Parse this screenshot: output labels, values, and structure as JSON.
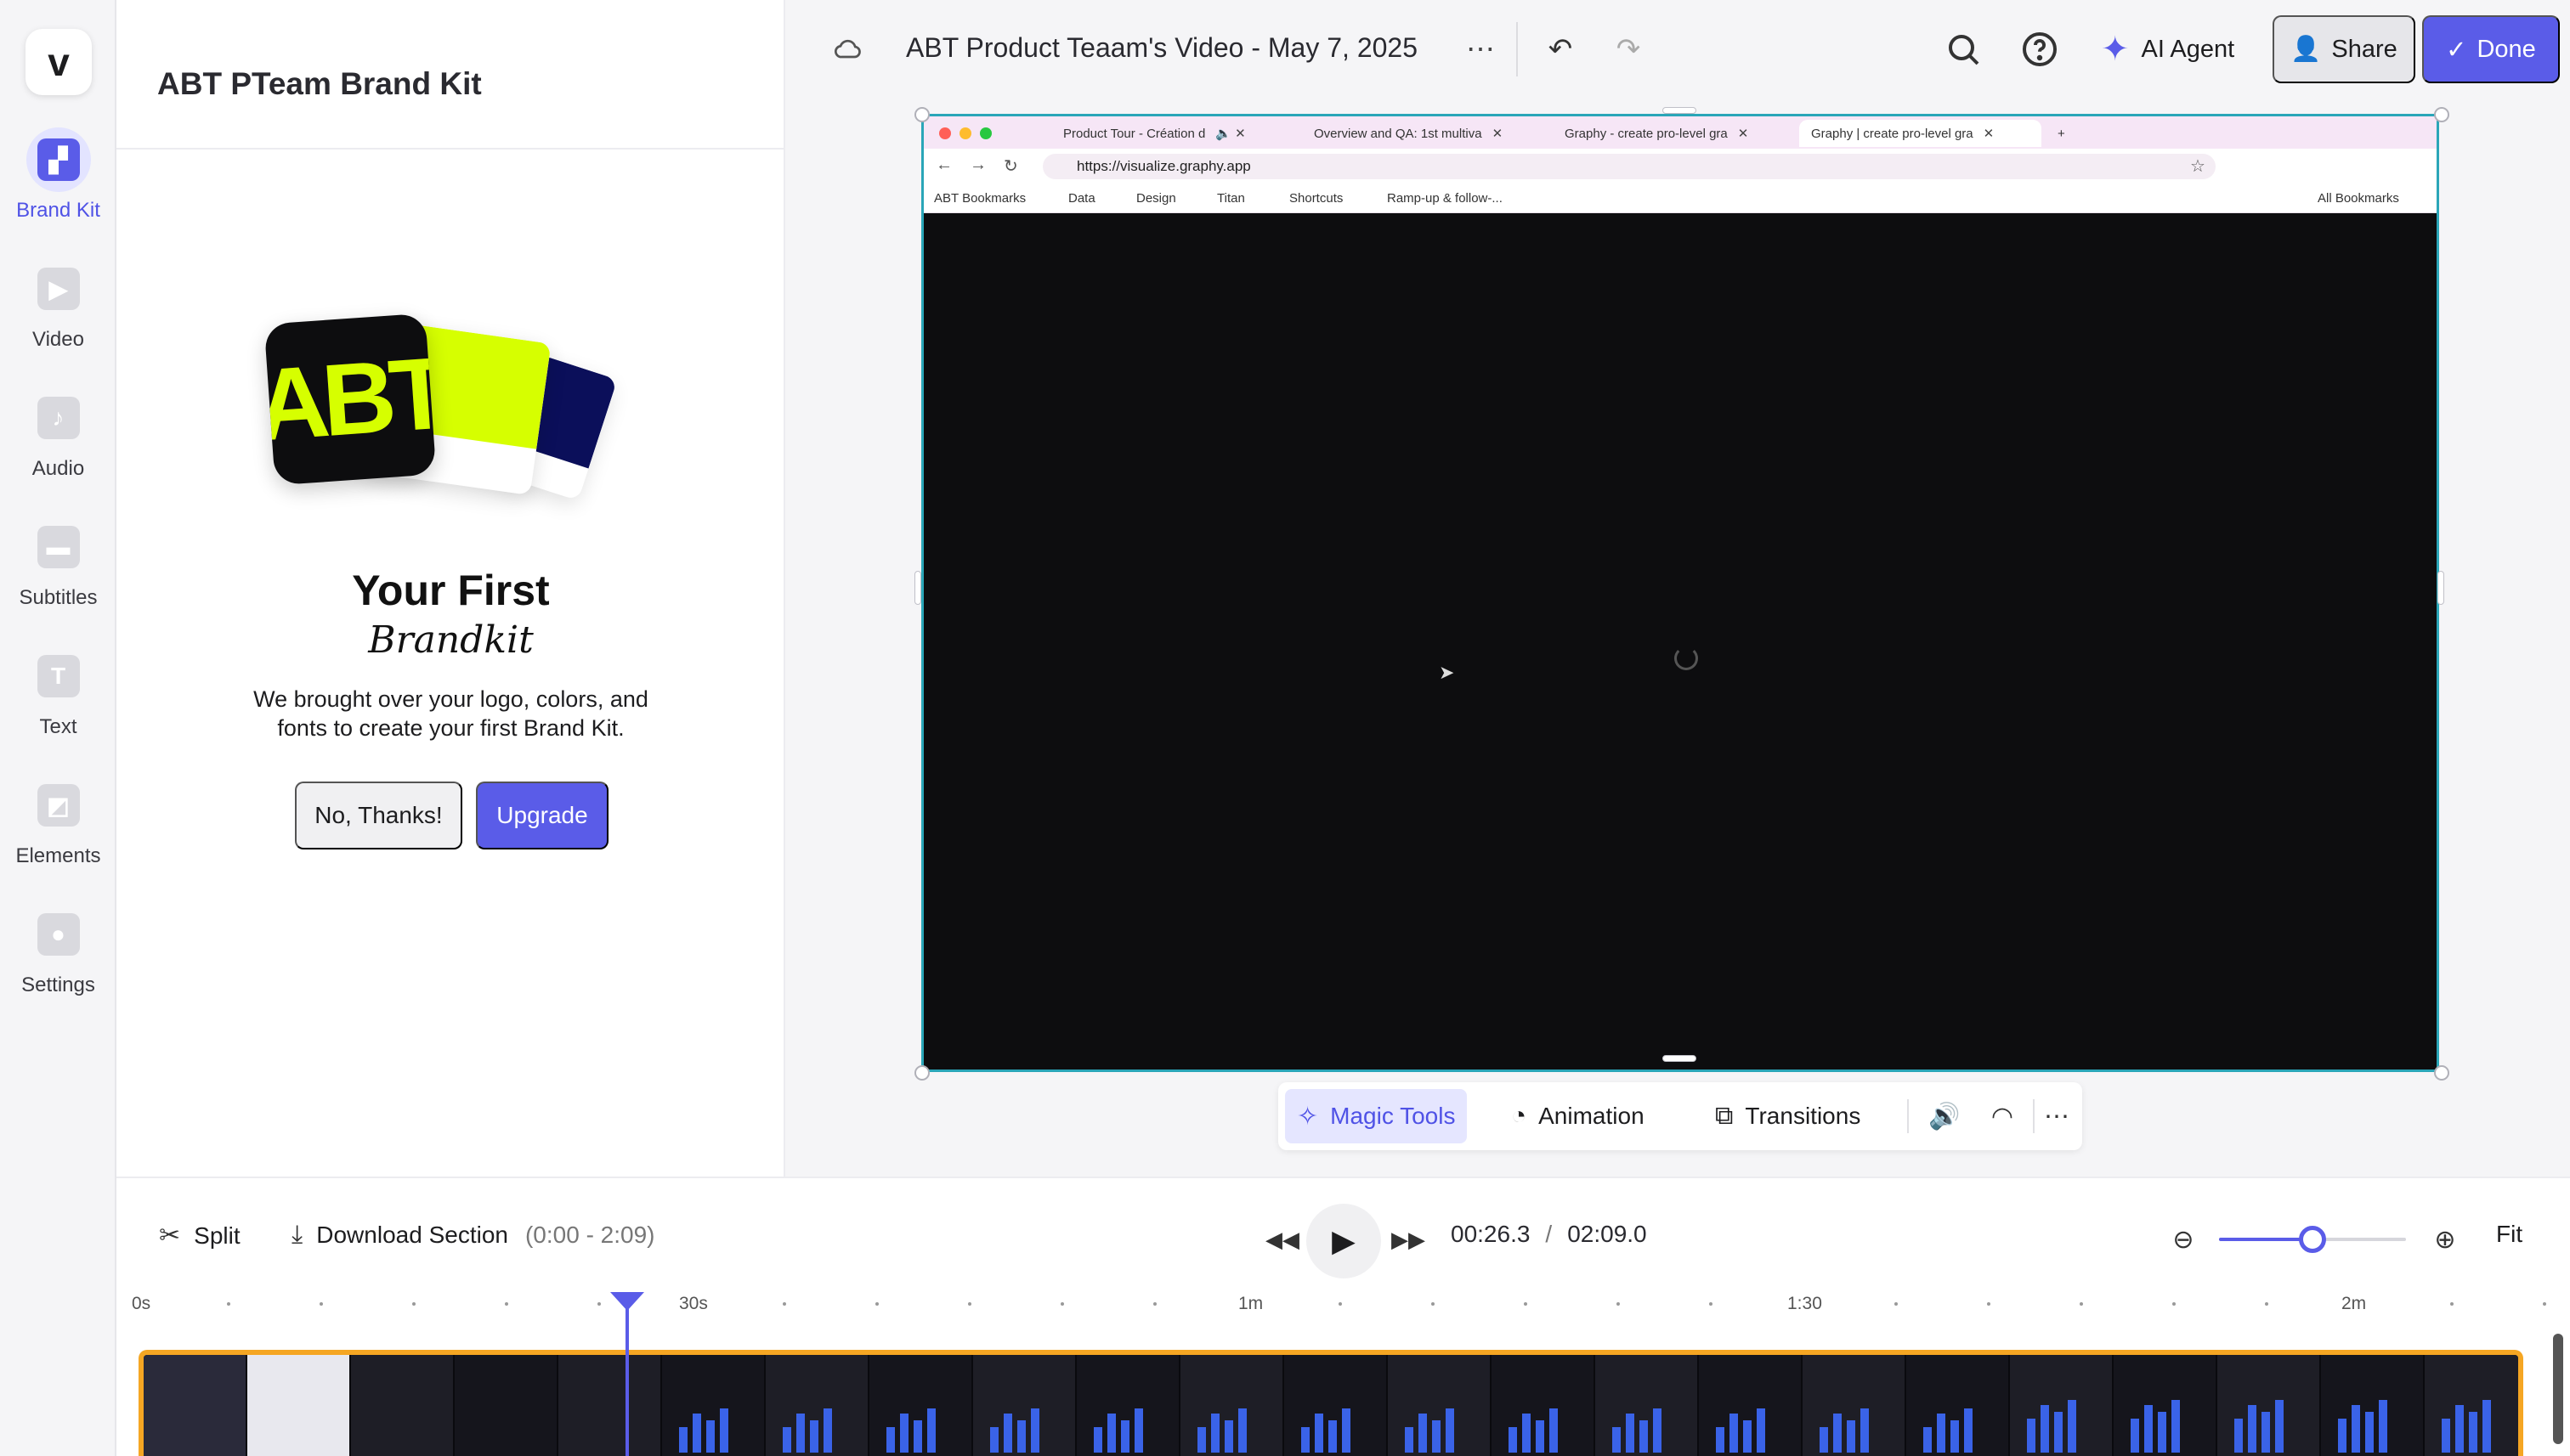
{
  "app": {
    "logo_letter": "v",
    "accent_color": "#5a5ce8",
    "border_highlight_color": "#f5a623"
  },
  "rail": {
    "items": [
      {
        "label": "Brand Kit",
        "icon": "brand-kit-icon",
        "active": true
      },
      {
        "label": "Video",
        "icon": "video-icon"
      },
      {
        "label": "Audio",
        "icon": "music-note-icon"
      },
      {
        "label": "Subtitles",
        "icon": "subtitles-icon"
      },
      {
        "label": "Text",
        "icon": "text-icon",
        "glyph": "T"
      },
      {
        "label": "Elements",
        "icon": "elements-icon"
      },
      {
        "label": "Settings",
        "icon": "settings-icon"
      }
    ]
  },
  "panel": {
    "title": "ABT PTeam Brand Kit",
    "logo_text": "ABT",
    "heading": "Your First",
    "subheading": "Brandkit",
    "description": "We brought over your logo, colors, and fonts to create your first Brand Kit.",
    "no_thanks": "No, Thanks!",
    "upgrade": "Upgrade",
    "brand_colors": [
      "#0d0d0f",
      "#d6ff00",
      "#0b0f5a"
    ]
  },
  "topbar": {
    "project_title": "ABT Product Teaam's Video - May 7, 2025",
    "ai_agent": "AI Agent",
    "share": "Share",
    "done": "Done"
  },
  "browser": {
    "tabs": [
      {
        "title": "Product Tour - Création d"
      },
      {
        "title": "Overview and QA: 1st multiva"
      },
      {
        "title": "Graphy - create pro-level gra"
      },
      {
        "title": "Graphy | create pro-level gra",
        "active": true
      }
    ],
    "url": "https://visualize.graphy.app",
    "bookmarks": [
      "ABT Bookmarks",
      "Data",
      "Design",
      "Titan",
      "Shortcuts",
      "Ramp-up & follow-..."
    ],
    "all_bookmarks": "All Bookmarks"
  },
  "canvas_toolbar": {
    "magic_tools": "Magic Tools",
    "animation": "Animation",
    "transitions": "Transitions"
  },
  "timeline": {
    "split": "Split",
    "download_section": "Download Section",
    "range": "(0:00 - 2:09)",
    "current_time": "00:26.3",
    "separator": "/",
    "total_time": "02:09.0",
    "fit": "Fit",
    "zoom_level": 0.5,
    "ruler_labels": [
      "0s",
      "30s",
      "1m",
      "1:30",
      "2m"
    ]
  }
}
